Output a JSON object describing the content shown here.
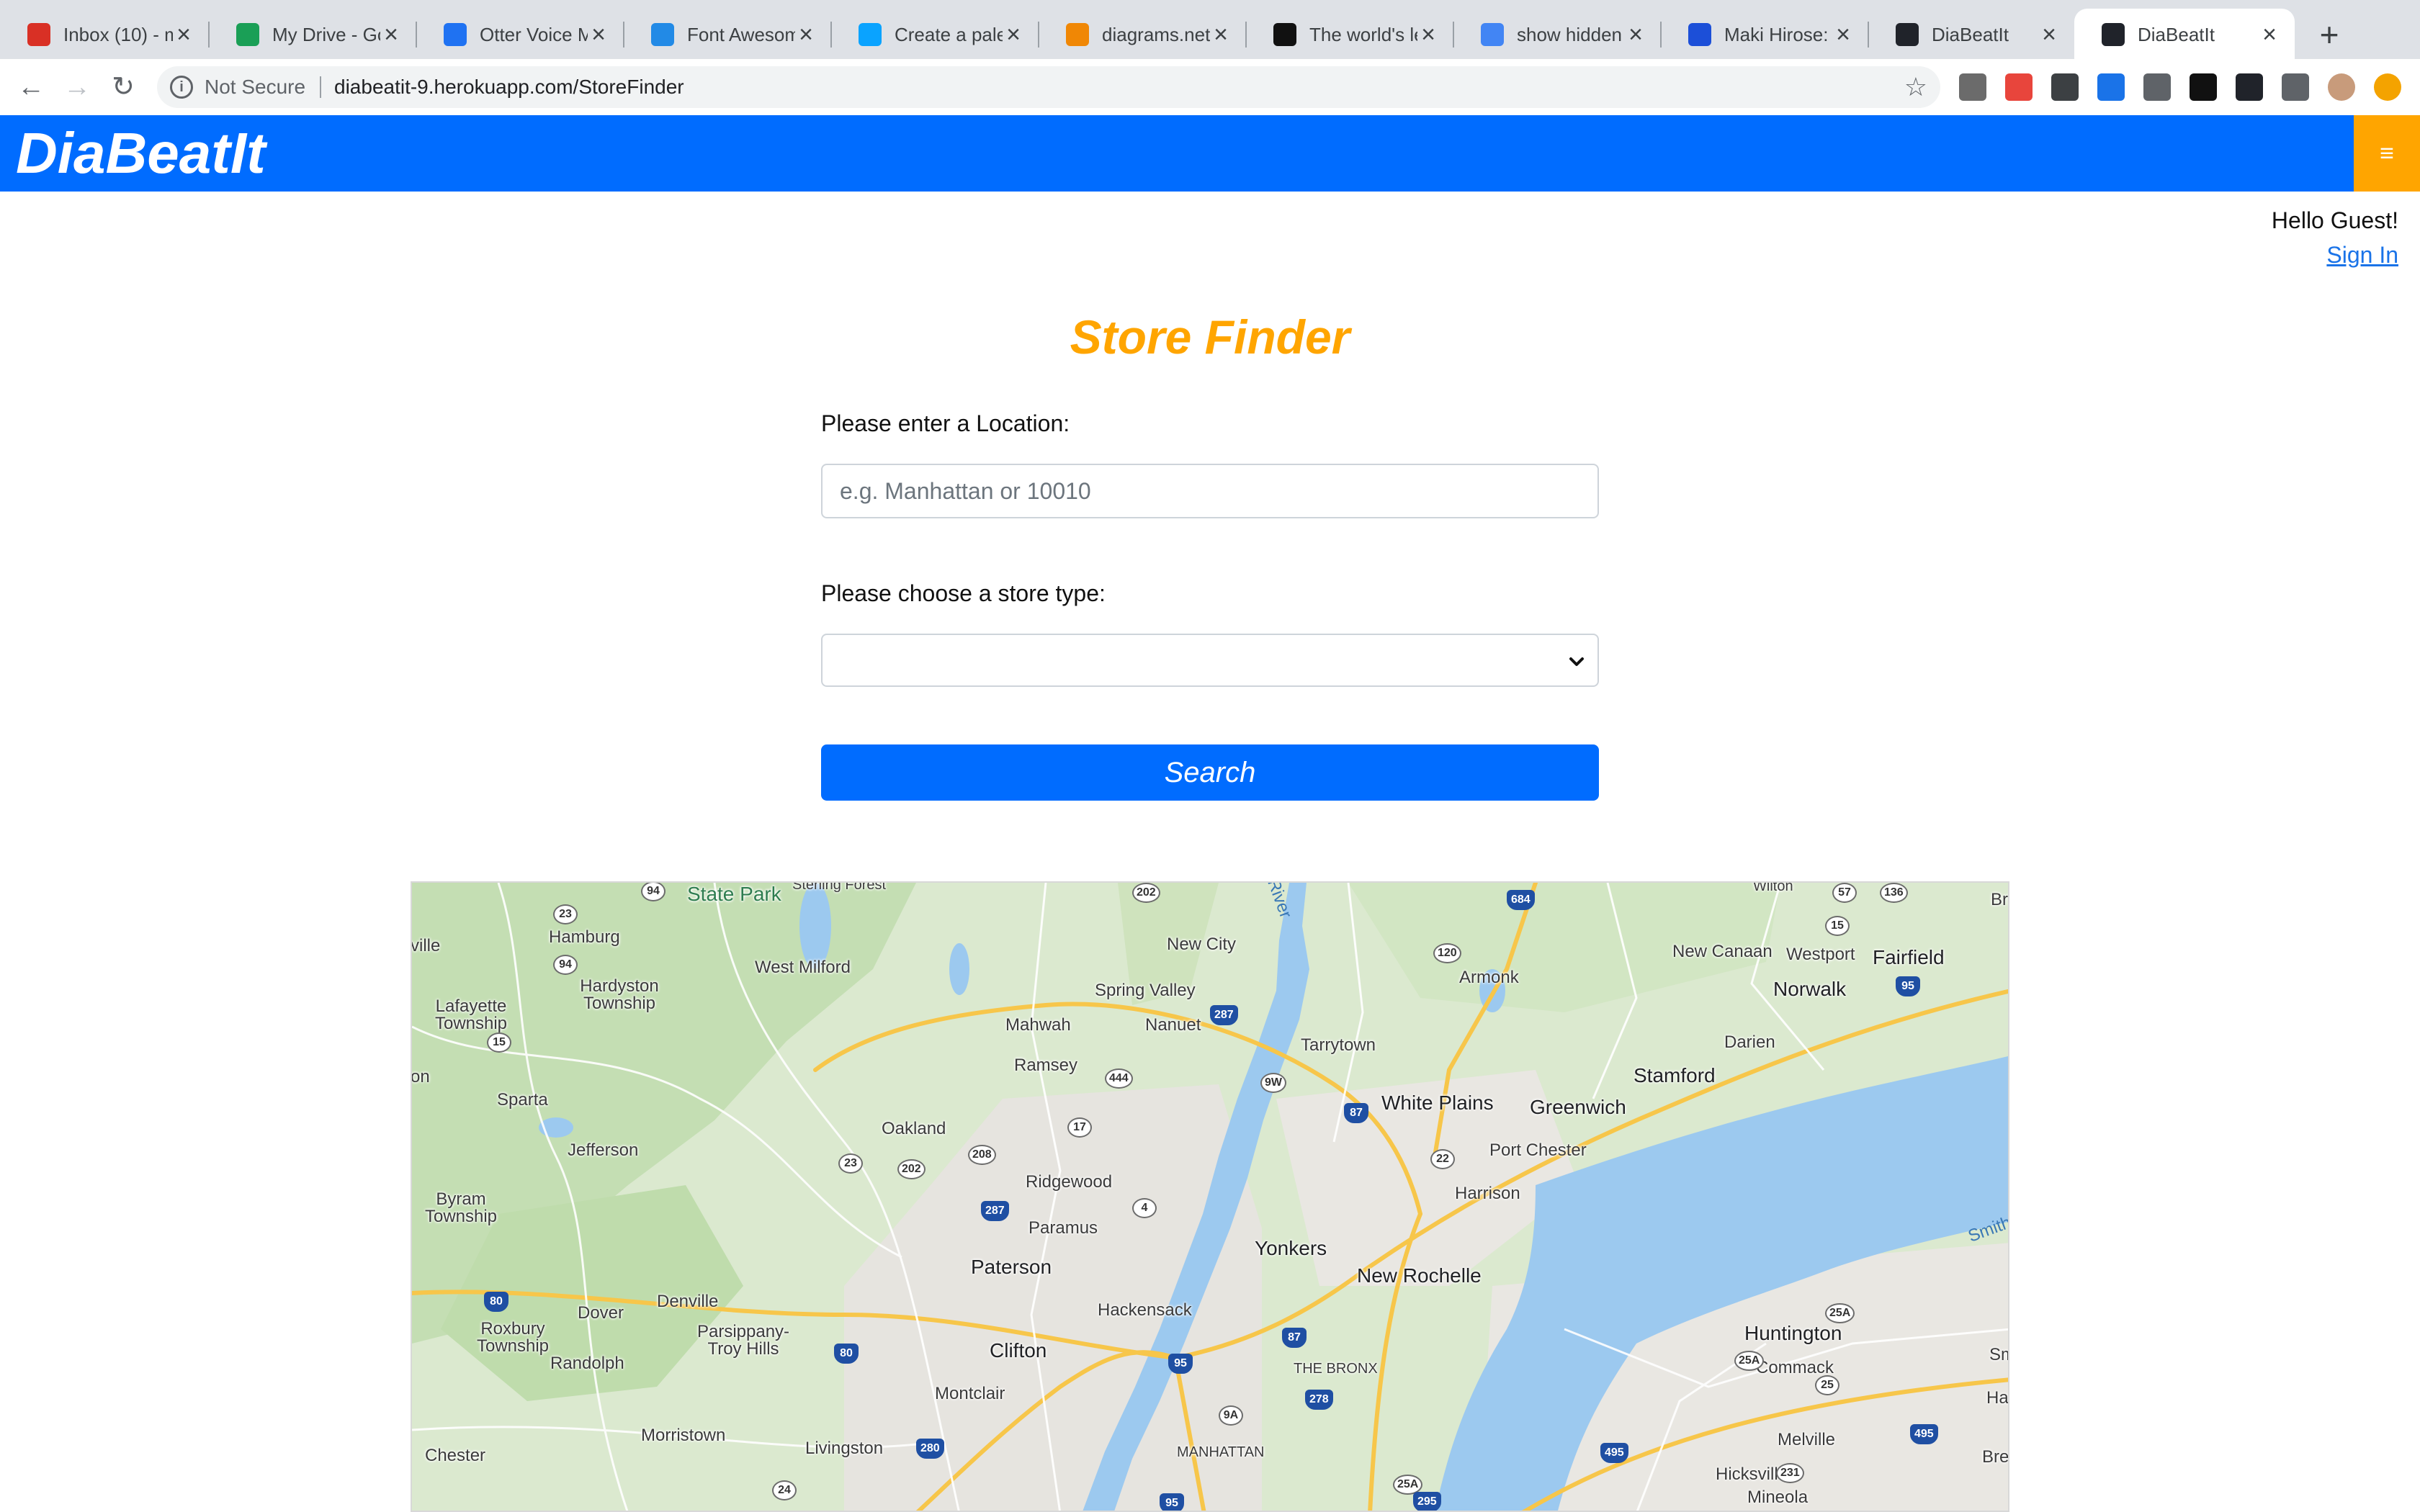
{
  "browser": {
    "tabs": [
      {
        "title": "Inbox (10) - m",
        "favicon": "gmail-icon",
        "color": "#d93025"
      },
      {
        "title": "My Drive - Go",
        "favicon": "google-drive-icon",
        "color": "#1a9f56"
      },
      {
        "title": "Otter Voice M",
        "favicon": "otter-icon",
        "color": "#1f72f2"
      },
      {
        "title": "Font Awesome",
        "favicon": "flag-icon",
        "color": "#228ae6"
      },
      {
        "title": "Create a palet",
        "favicon": "coolors-icon",
        "color": "#0aa3ff"
      },
      {
        "title": "diagrams.net",
        "favicon": "drawio-icon",
        "color": "#f08705"
      },
      {
        "title": "The world's le",
        "favicon": "github-icon",
        "color": "#111111"
      },
      {
        "title": "show hidden f",
        "favicon": "google-icon",
        "color": "#4285f4"
      },
      {
        "title": "Maki Hirose: L",
        "favicon": "square-icon",
        "color": "#1c4fd8"
      },
      {
        "title": "DiaBeatIt",
        "favicon": "react-icon",
        "color": "#20232a"
      },
      {
        "title": "DiaBeatIt",
        "favicon": "react-icon",
        "color": "#20232a"
      }
    ],
    "active_tab": 10,
    "security_label": "Not Secure",
    "url": "diabeatit-9.herokuapp.com/StoreFinder",
    "extensions": [
      "extension-icon-1",
      "extension-icon-2",
      "screenshot-icon",
      "arrows-icon",
      "circle-icon",
      "flag-icon",
      "react-devtools-icon",
      "puzzle-icon",
      "profile-avatar",
      "update-icon"
    ]
  },
  "app": {
    "brand": "DiaBeatIt",
    "menu_icon": "≡",
    "greeting": "Hello Guest!",
    "signin": "Sign In"
  },
  "finder": {
    "title": "Store Finder",
    "location_label": "Please enter a Location:",
    "location_placeholder": "e.g. Manhattan or 10010",
    "location_value": "",
    "store_type_label": "Please choose a store type:",
    "store_type_value": "",
    "search_label": "Search"
  },
  "map": {
    "places": [
      {
        "name": "State Park",
        "kind": "park"
      },
      {
        "name": "Sterling Forest",
        "kind": "small"
      },
      {
        "name": "ville",
        "kind": "mid"
      },
      {
        "name": "Hamburg",
        "kind": "mid"
      },
      {
        "name": "Hardyston Township",
        "kind": "mid"
      },
      {
        "name": "West Milford",
        "kind": "mid"
      },
      {
        "name": "New City",
        "kind": "mid"
      },
      {
        "name": "Spring Valley",
        "kind": "mid"
      },
      {
        "name": "Nanuet",
        "kind": "mid"
      },
      {
        "name": "Mahwah",
        "kind": "mid"
      },
      {
        "name": "Ramsey",
        "kind": "mid"
      },
      {
        "name": "Lafayette Township",
        "kind": "mid"
      },
      {
        "name": "Sparta",
        "kind": "mid"
      },
      {
        "name": "Jefferson",
        "kind": "mid"
      },
      {
        "name": "Oakland",
        "kind": "mid"
      },
      {
        "name": "Ridgewood",
        "kind": "mid"
      },
      {
        "name": "Paramus",
        "kind": "mid"
      },
      {
        "name": "Paterson",
        "kind": "big"
      },
      {
        "name": "Yonkers",
        "kind": "big"
      },
      {
        "name": "New Rochelle",
        "kind": "big"
      },
      {
        "name": "Tarrytown",
        "kind": "mid"
      },
      {
        "name": "White Plains",
        "kind": "big"
      },
      {
        "name": "Greenwich",
        "kind": "big"
      },
      {
        "name": "Port Chester",
        "kind": "mid"
      },
      {
        "name": "Harrison",
        "kind": "mid"
      },
      {
        "name": "Armonk",
        "kind": "mid"
      },
      {
        "name": "Stamford",
        "kind": "big"
      },
      {
        "name": "Darien",
        "kind": "mid"
      },
      {
        "name": "Norwalk",
        "kind": "big"
      },
      {
        "name": "New Canaan",
        "kind": "mid"
      },
      {
        "name": "Westport",
        "kind": "mid"
      },
      {
        "name": "Fairfield",
        "kind": "big"
      },
      {
        "name": "Wilton",
        "kind": "small"
      },
      {
        "name": "Hackensack",
        "kind": "mid"
      },
      {
        "name": "Clifton",
        "kind": "big"
      },
      {
        "name": "Montclair",
        "kind": "mid"
      },
      {
        "name": "Dover",
        "kind": "mid"
      },
      {
        "name": "Denville",
        "kind": "mid"
      },
      {
        "name": "Parsippany-Troy Hills",
        "kind": "mid"
      },
      {
        "name": "Roxbury Township",
        "kind": "mid"
      },
      {
        "name": "Randolph",
        "kind": "mid"
      },
      {
        "name": "Byram Township",
        "kind": "mid"
      },
      {
        "name": "Morristown",
        "kind": "mid"
      },
      {
        "name": "Chester",
        "kind": "mid"
      },
      {
        "name": "Livingston",
        "kind": "mid"
      },
      {
        "name": "THE BRONX",
        "kind": "small"
      },
      {
        "name": "MANHATTAN",
        "kind": "small"
      },
      {
        "name": "Huntington",
        "kind": "big"
      },
      {
        "name": "Commack",
        "kind": "mid"
      },
      {
        "name": "Melville",
        "kind": "mid"
      },
      {
        "name": "Hicksville",
        "kind": "mid"
      },
      {
        "name": "Mineola",
        "kind": "mid"
      },
      {
        "name": "Brentwoo",
        "kind": "mid"
      },
      {
        "name": "Hau",
        "kind": "mid"
      },
      {
        "name": "Sm",
        "kind": "mid"
      },
      {
        "name": "Bri",
        "kind": "mid"
      },
      {
        "name": "on",
        "kind": "mid"
      },
      {
        "name": "River",
        "kind": "water"
      },
      {
        "name": "Smith",
        "kind": "water"
      }
    ],
    "routes": [
      "94",
      "23",
      "94",
      "15",
      "202",
      "684",
      "120",
      "57",
      "136",
      "15",
      "95",
      "287",
      "444",
      "9W",
      "87",
      "22",
      "17",
      "208",
      "23",
      "202",
      "287",
      "4",
      "80",
      "80",
      "95",
      "87",
      "278",
      "9A",
      "280",
      "25A",
      "25A",
      "25",
      "495",
      "495",
      "231",
      "25A",
      "295",
      "24",
      "95"
    ]
  }
}
